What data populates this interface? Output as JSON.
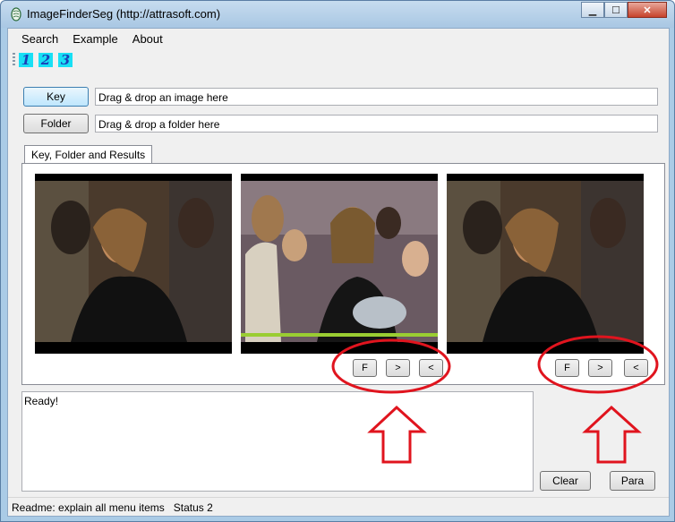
{
  "window": {
    "title": "ImageFinderSeg (http://attrasoft.com)",
    "controls": {
      "minimize": "▁",
      "maximize": "☐",
      "close": "✕"
    }
  },
  "menu": {
    "items": [
      "Search",
      "Example",
      "About"
    ]
  },
  "toolbar": {
    "buttons": [
      "1",
      "2",
      "3"
    ]
  },
  "inputs": {
    "key_button": "Key",
    "key_placeholder": "Drag & drop an image here",
    "folder_button": "Folder",
    "folder_placeholder": "Drag & drop a folder here"
  },
  "tabs": {
    "active": "Key, Folder and Results"
  },
  "image_panels": [
    {
      "name": "key-image",
      "buttons": []
    },
    {
      "name": "folder-image",
      "buttons": [
        "F",
        ">",
        "<"
      ]
    },
    {
      "name": "result-image",
      "buttons": [
        "F",
        ">",
        "<"
      ]
    }
  ],
  "output": {
    "text": "Ready!"
  },
  "actions": {
    "clear": "Clear",
    "para": "Para"
  },
  "status": {
    "readme": "Readme: explain all menu items",
    "status2": "Status 2"
  },
  "colors": {
    "annotation": "#e0141e",
    "toolbar_icon_bg": "#18e0f5"
  }
}
